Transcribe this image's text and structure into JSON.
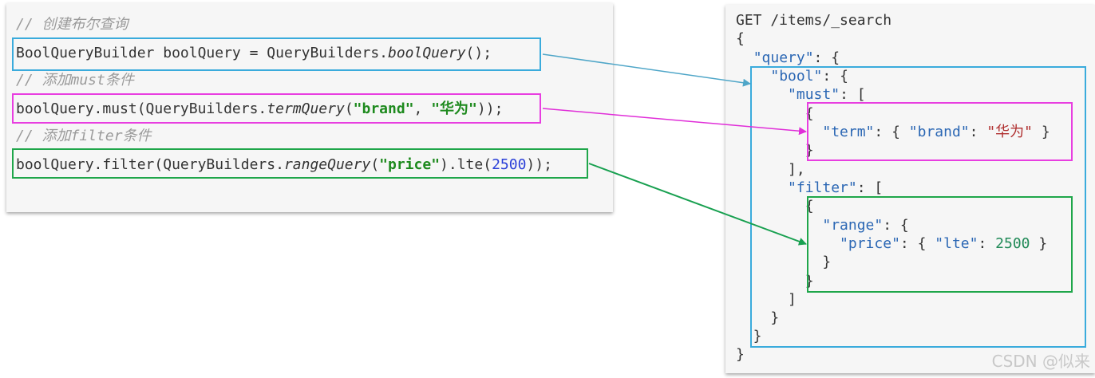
{
  "java": {
    "comment1": "// 创建布尔查询",
    "line1_prefix": "BoolQueryBuilder boolQuery = QueryBuilders.",
    "line1_method": "boolQuery",
    "line1_suffix": "();",
    "comment2": "// 添加must条件",
    "line2_prefix": "boolQuery.must(QueryBuilders.",
    "line2_method": "termQuery",
    "line2_open": "(",
    "line2_arg1": "\"brand\"",
    "line2_comma": ", ",
    "line2_arg2": "\"华为\"",
    "line2_suffix": "));",
    "comment3": "// 添加filter条件",
    "line3_prefix": "boolQuery.filter(QueryBuilders.",
    "line3_method": "rangeQuery",
    "line3_open": "(",
    "line3_arg1": "\"price\"",
    "line3_mid": ").lte(",
    "line3_num": "2500",
    "line3_suffix": "));"
  },
  "json": {
    "request_line": "GET /items/_search",
    "open_root": "{",
    "query_key": "\"query\"",
    "bool_key": "\"bool\"",
    "must_key": "\"must\"",
    "term_key": "\"term\"",
    "brand_key": "\"brand\"",
    "brand_value": "\"华为\"",
    "filter_key": "\"filter\"",
    "range_key": "\"range\"",
    "price_key": "\"price\"",
    "lte_key": "\"lte\"",
    "lte_value": "2500",
    "close_root": "}"
  },
  "colors": {
    "bool_box": "#3aabdc",
    "must_box": "#e83ee0",
    "filter_box": "#1fa64a",
    "bool_arrow": "#4fa6c8",
    "must_arrow": "#e02ed8",
    "filter_arrow": "#18a050"
  },
  "watermark": "CSDN @似来"
}
